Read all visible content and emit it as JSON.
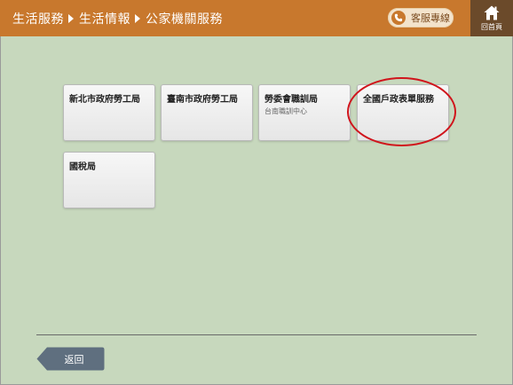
{
  "breadcrumb": [
    "生活服務",
    "生活情報",
    "公家機關服務"
  ],
  "service": {
    "label": "客服專線",
    "icon": "phone-icon"
  },
  "home": {
    "label": "回首頁",
    "icon": "home-icon"
  },
  "tiles": [
    {
      "title": "新北市政府勞工局",
      "subtitle": ""
    },
    {
      "title": "臺南市政府勞工局",
      "subtitle": ""
    },
    {
      "title": "勞委會職訓局",
      "subtitle": "台南職訓中心"
    },
    {
      "title": "全國戶政表單服務",
      "subtitle": ""
    },
    {
      "title": "國稅局",
      "subtitle": ""
    }
  ],
  "back": {
    "label": "返回"
  },
  "colors": {
    "header": "#c8782d",
    "background": "#c7d8bd",
    "highlight": "#d0141c",
    "home_button": "#6b4a2a",
    "back_button": "#5f6f7f"
  }
}
